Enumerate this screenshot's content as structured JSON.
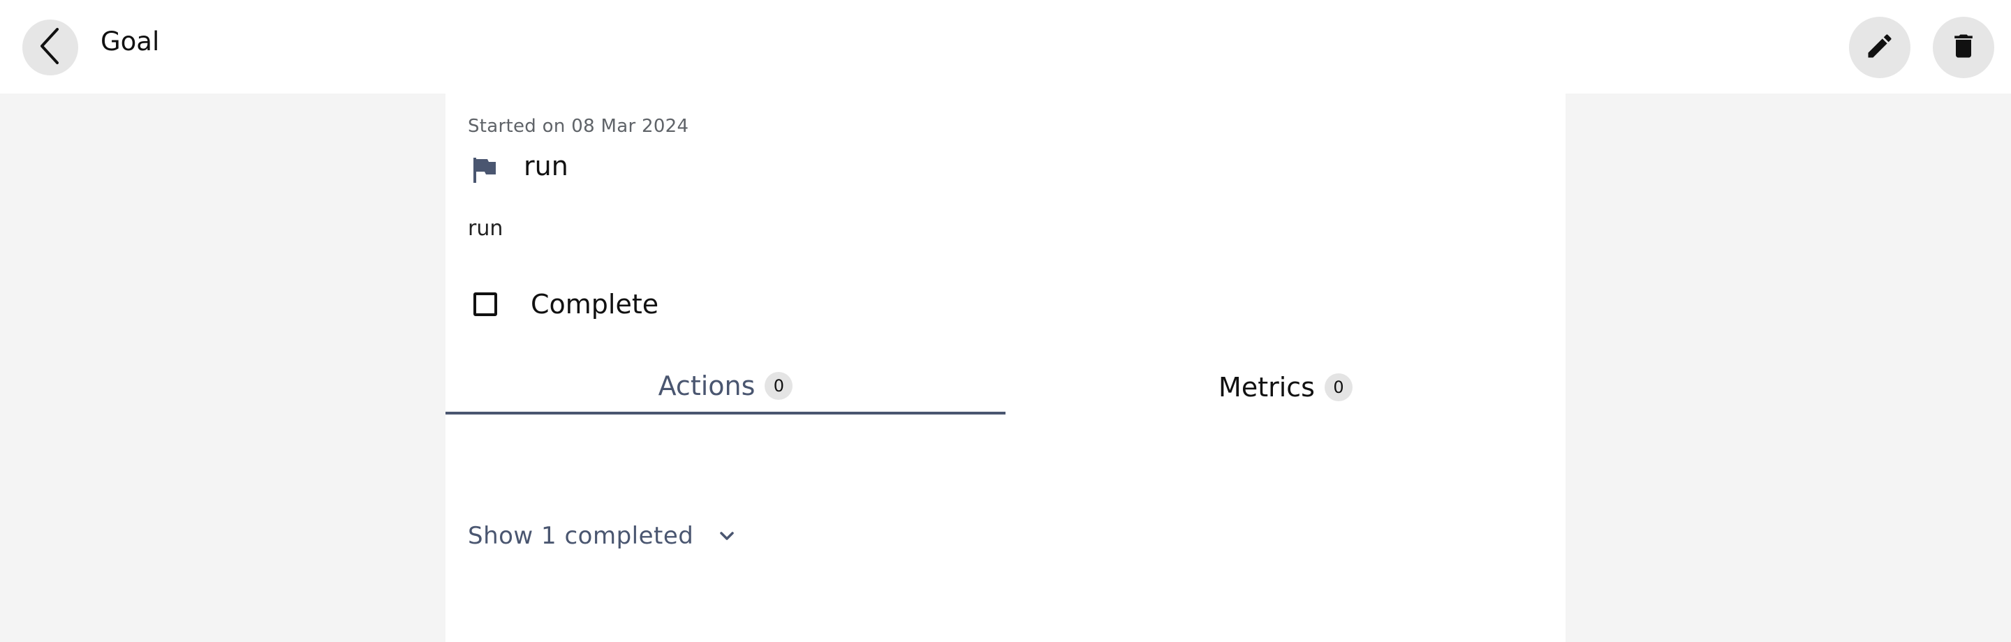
{
  "header": {
    "title": "Goal",
    "icons": {
      "back": "chevron-left-icon",
      "edit": "pencil-icon",
      "delete": "trash-icon"
    }
  },
  "goal": {
    "started": "Started on 08 Mar 2024",
    "name": "run",
    "description": "run",
    "flag_icon": "flag-icon",
    "flag_color": "#4a5670"
  },
  "complete": {
    "label": "Complete",
    "checked": false
  },
  "tabs": [
    {
      "label": "Actions",
      "count": "0",
      "active": true
    },
    {
      "label": "Metrics",
      "count": "0",
      "active": false
    }
  ],
  "show_completed": {
    "label": "Show 1 completed",
    "icon": "chevron-down-icon"
  },
  "colors": {
    "accent": "#4a5670",
    "background": "#f4f4f4",
    "surface": "#ffffff"
  }
}
